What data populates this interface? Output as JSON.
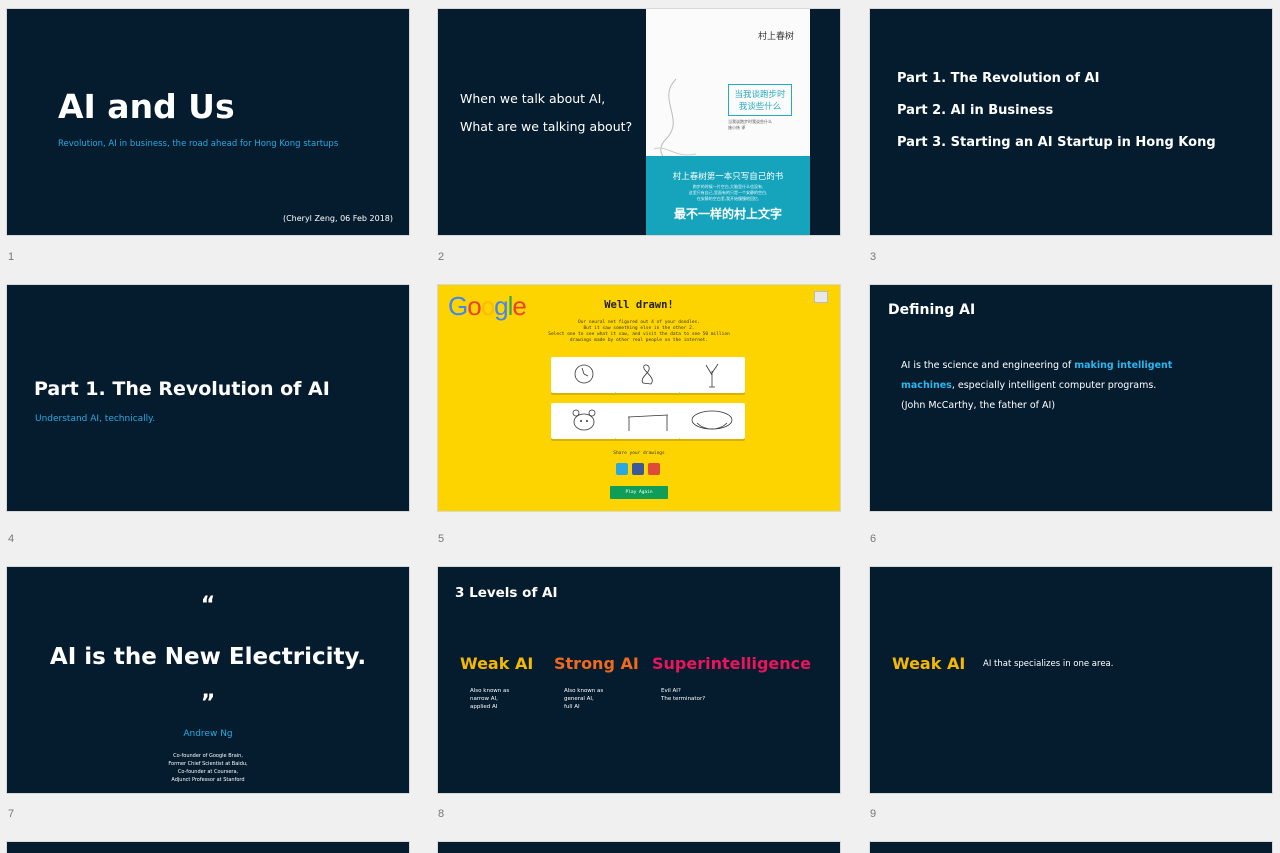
{
  "slide_numbers": [
    "1",
    "2",
    "3",
    "4",
    "5",
    "6",
    "7",
    "8",
    "9"
  ],
  "s1": {
    "title": "AI and Us",
    "subtitle": "Revolution, AI in business, the road ahead for Hong Kong startups",
    "footer": "(Cheryl Zeng, 06 Feb 2018)"
  },
  "s2": {
    "line1": "When we talk about AI,",
    "line2": "What are we talking about?",
    "book": {
      "author": "村上春树",
      "title_l1": "当我谈跑步时",
      "title_l2": "我谈些什么",
      "small_l1": "当我谈跑步时我谈些什么",
      "small_l2": "施小炜 译",
      "banner": "村上春树第一本只写自己的书",
      "banner_sub1": "跑步的时候一片空白,大脑里什么也没有,",
      "banner_sub2": "这里只有自己,里面有的只是一个安静的空白,",
      "banner_sub3": "在安静的空白里,我开始慢慢地回忆,",
      "big": "最不一样的村上文字"
    }
  },
  "s3": {
    "items": [
      "Part 1.  The Revolution of AI",
      "Part 2.  AI in Business",
      "Part 3.  Starting an AI Startup in Hong Kong"
    ]
  },
  "s4": {
    "title": "Part 1. The Revolution of AI",
    "subtitle": "Understand AI, technically."
  },
  "s5": {
    "logo": "Google",
    "heading": "Well drawn!",
    "desc1": "Our neural net figured out 4 of your doodles.",
    "desc2": "But it saw something else in the other 2.",
    "desc3": "Select one to see what it saw, and visit the data to see 50 million",
    "desc4": "drawings made by other real people on the internet.",
    "share": "Share your drawings",
    "play": "Play Again",
    "logo_colors": [
      "#4285f4",
      "#ea4335",
      "#fbbc05",
      "#4285f4",
      "#34a853",
      "#ea4335"
    ]
  },
  "s6": {
    "title": "Defining AI",
    "body_pre": "AI is the science and engineering of ",
    "body_hl1": "making intelligent",
    "body_hl2": "machines",
    "body_post": ", especially intelligent computer programs.",
    "cite": "(John McCarthy, the father of AI)"
  },
  "s7": {
    "open_quote": "“",
    "quote": "AI is the New Electricity.",
    "close_quote": "”",
    "author": "Andrew Ng",
    "role1": "Co-founder of Google Brain,",
    "role2": "Former Chief Scientist at Baidu,",
    "role3": "Co-founder at Coursera,",
    "role4": "Adjunct Professor at Stanford"
  },
  "s8": {
    "title": "3 Levels of AI",
    "levels": [
      {
        "name": "Weak AI",
        "color": "#f5b800",
        "d1": "Also known as",
        "d2": "narrow AI,",
        "d3": "applied AI"
      },
      {
        "name": "Strong AI",
        "color": "#f06a1e",
        "d1": "Also known as",
        "d2": "general AI,",
        "d3": "full AI"
      },
      {
        "name": "Superintelligence",
        "color": "#e8155c",
        "d1": "Evil AI?",
        "d2": "The terminator?",
        "d3": ""
      }
    ]
  },
  "s9": {
    "name": "Weak AI",
    "desc": "AI that specializes in one area."
  },
  "colors": {
    "slide_bg": "#051c2f",
    "accent": "#2ba9e0",
    "google_yellow": "#fdd400"
  }
}
